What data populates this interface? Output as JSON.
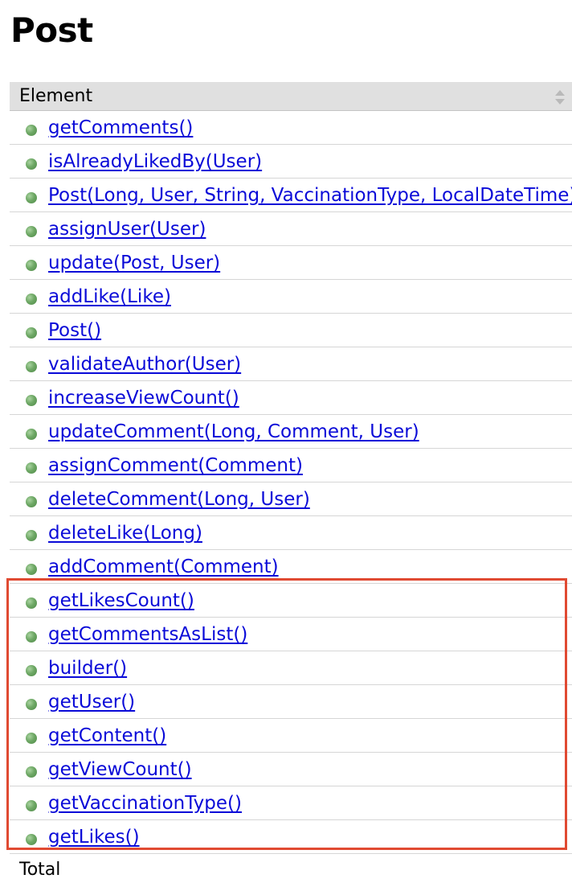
{
  "page": {
    "title": "Post"
  },
  "table": {
    "header_label": "Element",
    "total_label": "Total",
    "rows": [
      {
        "label": "getComments()"
      },
      {
        "label": "isAlreadyLikedBy(User)"
      },
      {
        "label": "Post(Long, User, String, VaccinationType, LocalDateTime)"
      },
      {
        "label": "assignUser(User)"
      },
      {
        "label": "update(Post, User)"
      },
      {
        "label": "addLike(Like)"
      },
      {
        "label": "Post()"
      },
      {
        "label": "validateAuthor(User)"
      },
      {
        "label": "increaseViewCount()"
      },
      {
        "label": "updateComment(Long, Comment, User)"
      },
      {
        "label": "assignComment(Comment)"
      },
      {
        "label": "deleteComment(Long, User)"
      },
      {
        "label": "deleteLike(Long)"
      },
      {
        "label": "addComment(Comment)"
      },
      {
        "label": "getLikesCount()"
      },
      {
        "label": "getCommentsAsList()"
      },
      {
        "label": "builder()"
      },
      {
        "label": "getUser()"
      },
      {
        "label": "getContent()"
      },
      {
        "label": "getViewCount()"
      },
      {
        "label": "getVaccinationType()"
      },
      {
        "label": "getLikes()"
      }
    ]
  },
  "colors": {
    "link": "#0a0ad8",
    "header_bg": "#e0e0e0",
    "highlight": "#e04a32",
    "method_dot": "#6ea865"
  },
  "icons": {
    "sort": "sort-icon",
    "method": "method-dot-icon"
  }
}
